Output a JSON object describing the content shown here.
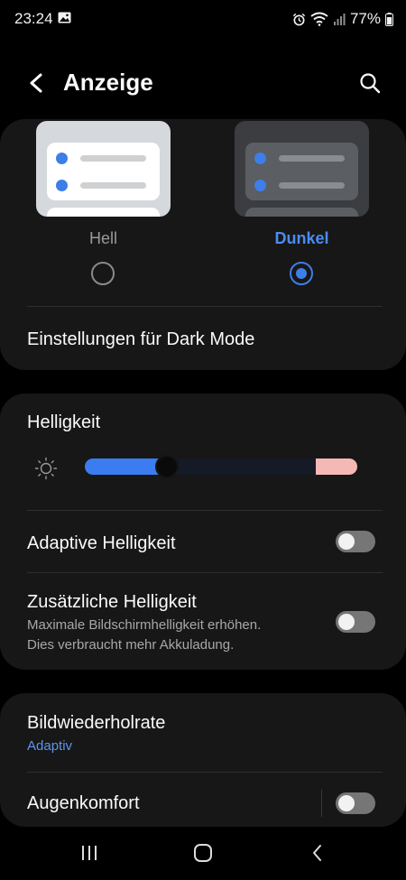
{
  "status_bar": {
    "time": "23:24",
    "battery": "77%",
    "icons": [
      "gallery-icon",
      "alarm-icon",
      "wifi-icon",
      "signal-icon",
      "battery-icon"
    ]
  },
  "header": {
    "title": "Anzeige",
    "back_icon": "back-arrow-icon",
    "search_icon": "search-icon"
  },
  "theme": {
    "options": [
      {
        "label": "Hell",
        "selected": false
      },
      {
        "label": "Dunkel",
        "selected": true
      }
    ],
    "dark_mode_settings": "Einstellungen für Dark Mode",
    "accent_color": "#3e7ee8"
  },
  "brightness": {
    "title": "Helligkeit",
    "level": 0.3,
    "adaptive": {
      "label": "Adaptive Helligkeit",
      "enabled": false
    },
    "extra": {
      "label": "Zusätzliche Helligkeit",
      "description_line1": "Maximale Bildschirmhelligkeit erhöhen.",
      "description_line2": "Dies verbraucht mehr Akkuladung.",
      "enabled": false
    }
  },
  "display": {
    "refresh_rate": {
      "label": "Bildwiederholrate",
      "value": "Adaptiv"
    },
    "eye_comfort": {
      "label": "Augenkomfort",
      "enabled": false
    }
  },
  "nav": {
    "icons": [
      "recent-apps-icon",
      "home-icon",
      "back-icon"
    ]
  }
}
